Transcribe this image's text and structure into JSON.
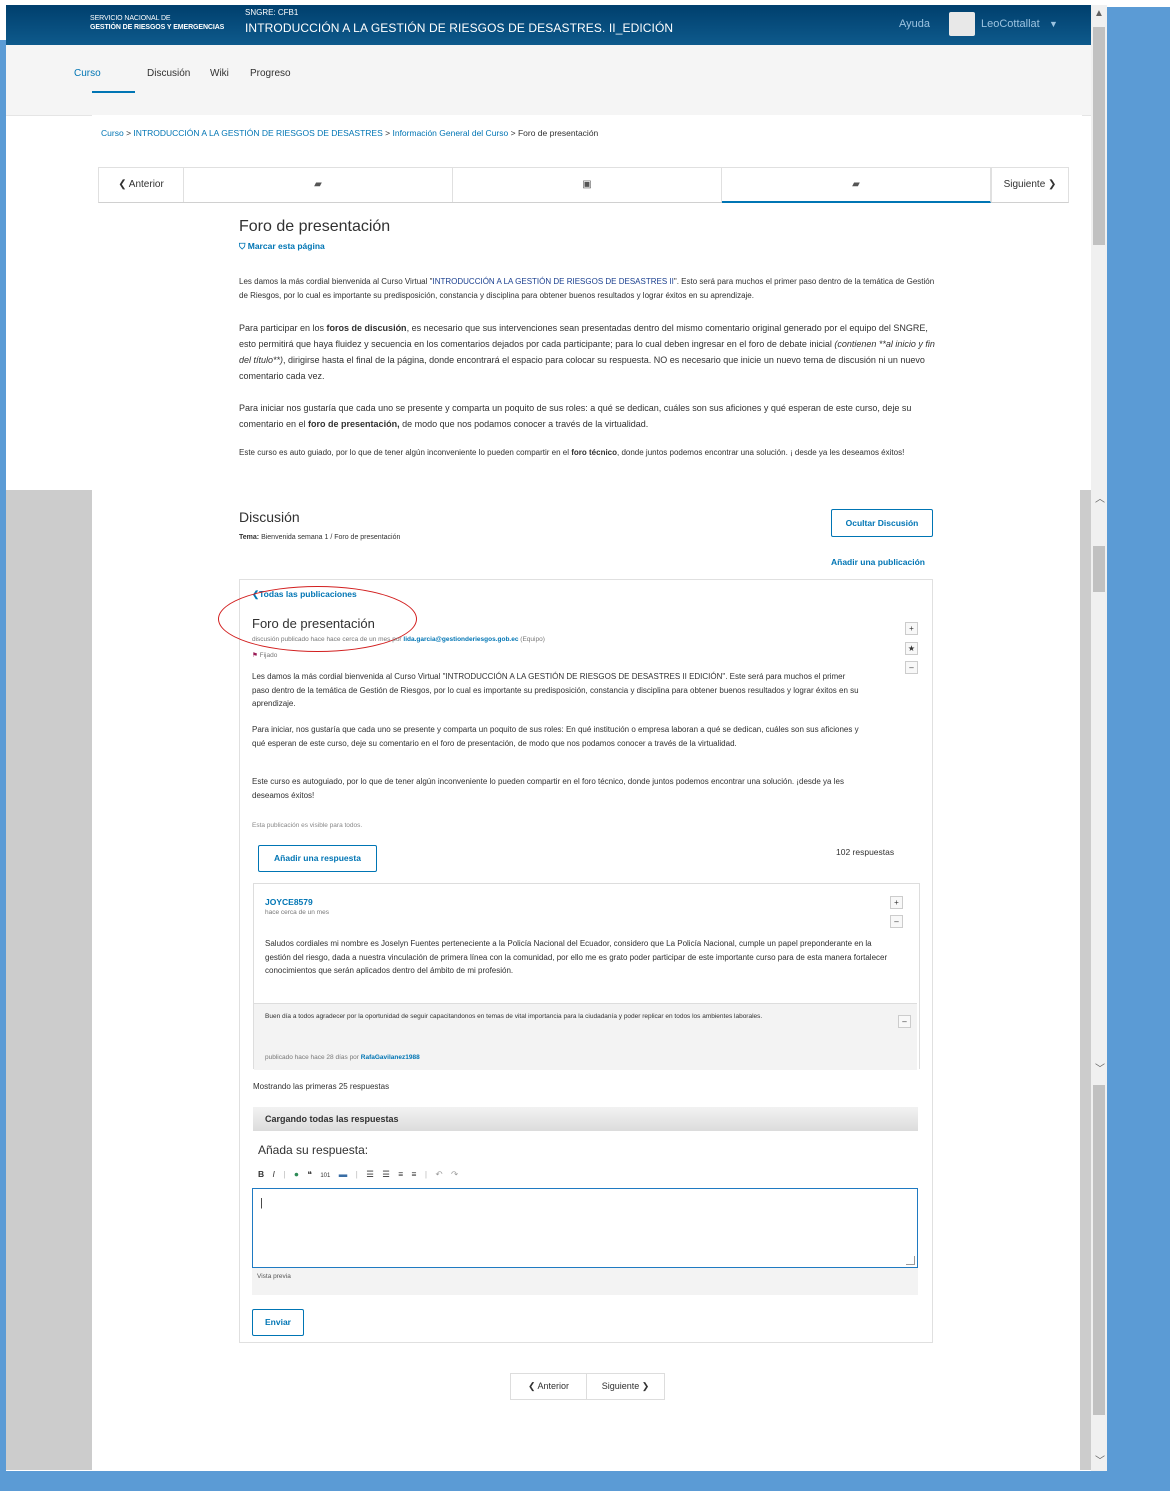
{
  "header": {
    "org_line1": "SERVICIO NACIONAL DE",
    "org_line2": "GESTIÓN DE RIESGOS Y EMERGENCIAS",
    "course_code": "SNGRE: CFB1",
    "course_title": "INTRODUCCIÓN A LA GESTIÓN DE RIESGOS DE DESASTRES. II_EDICIÓN",
    "help": "Ayuda",
    "username": "LeoCottallat"
  },
  "nav": {
    "tabs": [
      "Curso",
      "Discusión",
      "Wiki",
      "Progreso"
    ]
  },
  "breadcrumb": {
    "items": [
      "Curso",
      "INTRODUCCIÓN A LA GESTIÓN DE RIESGOS DE DESASTRES",
      "Información General del Curso"
    ],
    "current": "Foro de presentación",
    "sep": ">"
  },
  "sequence": {
    "prev": "Anterior",
    "next": "Siguiente"
  },
  "page": {
    "title": "Foro de presentación",
    "bookmark": "Marcar esta página",
    "p1_a": "Les damos la más cordial bienvenida al Curso Virtual \"",
    "p1_b": "INTRODUCCIÓN A LA GESTIÓN DE RIESGOS DE DESASTRES II",
    "p1_c": "\". Esto será para muchos el primer paso dentro de la temática de Gestión de Riesgos, por lo cual es importante su predisposición, constancia y disciplina para obtener buenos resultados y lograr éxitos en su aprendizaje.",
    "p2_a": "Para participar en los ",
    "p2_b": "foros de discusión",
    "p2_c": ", es necesario que sus intervenciones sean presentadas dentro del mismo comentario original generado por el equipo del SNGRE, esto permitirá que haya fluidez y secuencia en los comentarios dejados por cada participante; para lo cual deben ingresar en el foro de debate inicial ",
    "p2_d": "(contienen **al inicio y fin del título**)",
    "p2_e": ", dirigirse hasta el final de la página, donde encontrará el espacio para colocar su respuesta. NO es necesario que inicie un nuevo tema de discusión ni un nuevo comentario cada vez.",
    "p3_a": "Para iniciar nos gustaría que cada uno se presente y comparta un poquito de sus roles: a qué se dedican, cuáles son sus aficiones y qué esperan de este curso, deje su comentario en el ",
    "p3_b": "foro de presentación,",
    "p3_c": " de modo que nos podamos conocer a través de la virtualidad.",
    "p4_a": "Este curso es auto guiado, por lo que de tener algún inconveniente lo pueden compartir en el ",
    "p4_b": "foro técnico",
    "p4_c": ", donde juntos podemos encontrar una solución. ¡ desde ya les deseamos éxitos!"
  },
  "discussion": {
    "title": "Discusión",
    "topic_label": "Tema:",
    "topic": "Bienvenida semana 1 / Foro de presentación",
    "hide_button": "Ocultar Discusión",
    "add_post": "Añadir una publicación",
    "all_posts": "Todas las publicaciones",
    "thread": {
      "title": "Foro de presentación",
      "meta_prefix": "discusión publicado hace hace cerca de un mes por",
      "author": "lida.garcia@gestionderiesgos.gob.ec",
      "role": "(Equipo)",
      "pinned": "Fijado",
      "body1": "Les damos la más cordial bienvenida al Curso Virtual \"INTRODUCCIÓN A LA GESTIÓN DE RIESGOS DE DESASTRES II EDICIÓN\". Este será para muchos el primer paso dentro de la temática de Gestión de Riesgos, por lo cual es importante su predisposición, constancia y disciplina para obtener buenos resultados y lograr éxitos en su aprendizaje.",
      "body2": "Para iniciar, nos gustaría que cada uno se presente y comparta un poquito de sus roles: En qué institución o empresa laboran a qué se dedican, cuáles son sus aficiones y qué esperan de este curso, deje su comentario en el foro de presentación, de modo que nos podamos conocer a través de la virtualidad.",
      "body3": "Este curso es autoguiado, por lo que de tener algún inconveniente lo pueden compartir en el foro técnico, donde juntos podemos encontrar una solución. ¡desde ya les deseamos éxitos!",
      "visibility": "Esta publicación es visible para todos.",
      "reply_button": "Añadir una respuesta",
      "response_count": "102 respuestas"
    },
    "response": {
      "author": "JOYCE8579",
      "time": "hace cerca de un mes",
      "body": "Saludos cordiales mi nombre es Joselyn Fuentes perteneciente a la Policía Nacional del Ecuador, considero que La Policía Nacional, cumple un papel preponderante en la gestión del riesgo, dada a nuestra vinculación de primera línea con la comunidad, por ello me es grato poder participar de este importante curso para de esta manera fortalecer conocimientos que serán aplicados dentro del ámbito de mi profesión."
    },
    "comment": {
      "body": "Buen día a todos agradecer por la oportunidad de seguir capacitandonos en temas de vital importancia para la ciudadanía y poder replicar en todos los ambientes laborales.",
      "meta_prefix": "publicado hace hace 28 días por",
      "author": "RafaGavilanez1988"
    },
    "showing": "Mostrando las primeras 25 respuestas",
    "loading": "Cargando todas las respuestas",
    "your_reply": "Añada su respuesta:",
    "editor_value": "|",
    "preview": "Vista previa",
    "send": "Enviar"
  },
  "bottom_nav": {
    "prev": "Anterior",
    "next": "Siguiente"
  },
  "colors": {
    "accent": "#0075b4",
    "header": "#0e4f80",
    "annotation": "#d21f1f",
    "background": "#5b9bd5"
  }
}
